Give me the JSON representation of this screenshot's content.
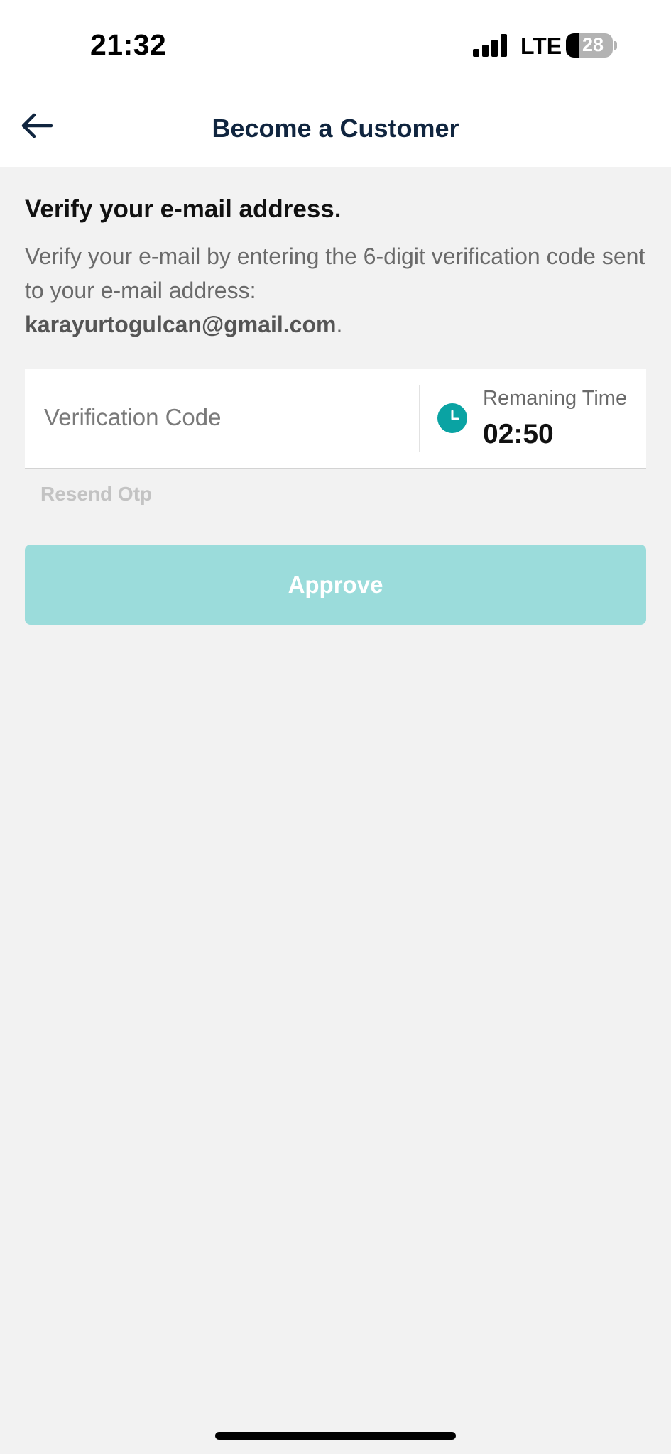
{
  "status_bar": {
    "time": "21:32",
    "network": "LTE",
    "battery": "28",
    "battery_level": 0.28,
    "signal_icon": "cellular-signal-icon",
    "battery_icon": "battery-icon"
  },
  "nav": {
    "title": "Become a Customer",
    "back_icon": "arrow-left-icon"
  },
  "verify": {
    "heading": "Verify your e-mail address.",
    "description": "Verify your e-mail by entering the 6-digit verification code sent to your e-mail address:",
    "email": "karayurtogulcan@gmail.com",
    "email_suffix": "."
  },
  "code_field": {
    "placeholder": "Verification Code",
    "value": ""
  },
  "timer": {
    "icon": "clock-icon",
    "label": "Remaning Time",
    "value": "02:50"
  },
  "resend": {
    "label": "Resend Otp"
  },
  "approve": {
    "label": "Approve"
  },
  "colors": {
    "accent": "#0aa3a3",
    "button_disabled": "#9bdcdb",
    "title": "#10253f",
    "background": "#f2f2f2"
  }
}
